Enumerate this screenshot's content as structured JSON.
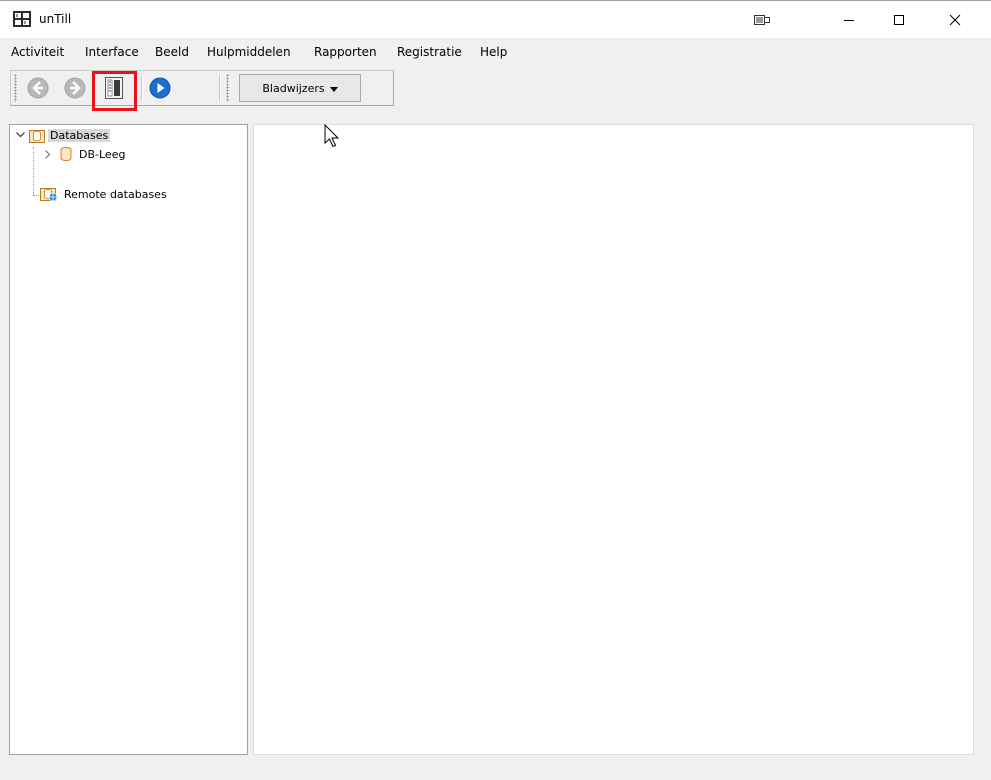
{
  "window": {
    "title": "unTill",
    "controls": [
      "keyboard-icon",
      "minimize-icon",
      "maximize-icon",
      "close-icon"
    ]
  },
  "menu": {
    "items": [
      "Activiteit",
      "Interface",
      "Beeld",
      "Hulpmiddelen",
      "Rapporten",
      "Registratie",
      "Help"
    ]
  },
  "toolbar": {
    "buttons": [
      "back-icon",
      "forward-icon",
      "panel-toggle-icon",
      "run-icon"
    ],
    "bookmarks_label": "Bladwijzers"
  },
  "tree": {
    "root_label": "Databases",
    "child_label": "DB-Leeg",
    "remote_label": "Remote databases"
  },
  "colors": {
    "highlight": "#e8131a",
    "run_blue": "#1a6fd1",
    "db_orange": "#e07b2a"
  }
}
